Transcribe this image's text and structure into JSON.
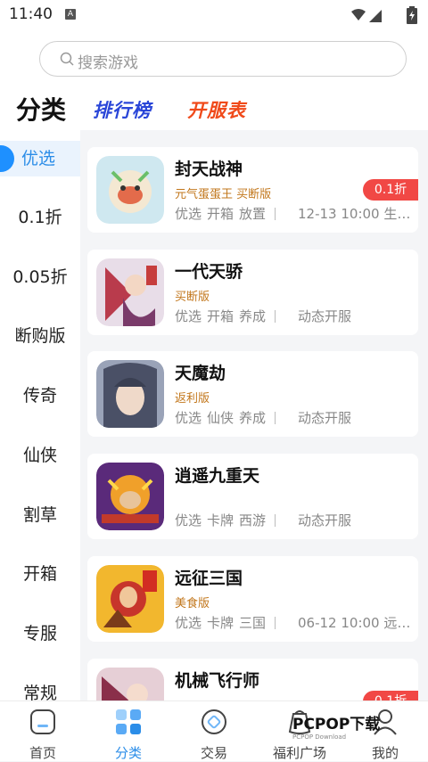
{
  "status_bar": {
    "time": "11:40",
    "notif_icon": "A"
  },
  "search": {
    "placeholder": "搜索游戏"
  },
  "tabs": {
    "main": "分类",
    "rank": "排行榜",
    "server": "开服表"
  },
  "sidebar": {
    "items": [
      {
        "label": "优选",
        "active": true
      },
      {
        "label": "0.1折"
      },
      {
        "label": "0.05折"
      },
      {
        "label": "断购版"
      },
      {
        "label": "传奇"
      },
      {
        "label": "仙侠"
      },
      {
        "label": "割草"
      },
      {
        "label": "开箱"
      },
      {
        "label": "专服"
      },
      {
        "label": "常规"
      }
    ]
  },
  "games": [
    {
      "name": "封天战神",
      "subtitle": "元气蛋蛋王 买断版",
      "tags": [
        "优选",
        "开箱",
        "放置"
      ],
      "open": "12-13 10:00 生…",
      "discount": "0.1折"
    },
    {
      "name": "一代天骄",
      "subtitle": "买断版",
      "tags": [
        "优选",
        "开箱",
        "养成"
      ],
      "open": "动态开服",
      "discount": ""
    },
    {
      "name": "天魔劫",
      "subtitle": "返利版",
      "tags": [
        "优选",
        "仙侠",
        "养成"
      ],
      "open": "动态开服",
      "discount": ""
    },
    {
      "name": "逍遥九重天",
      "subtitle": "",
      "tags": [
        "优选",
        "卡牌",
        "西游"
      ],
      "open": "动态开服",
      "discount": ""
    },
    {
      "name": "远征三国",
      "subtitle": "美食版",
      "tags": [
        "优选",
        "卡牌",
        "三国"
      ],
      "open": "06-12 10:00 远…",
      "discount": ""
    },
    {
      "name": "机械飞行师",
      "subtitle": "",
      "tags": [],
      "open": "",
      "discount": "0.1折"
    }
  ],
  "bottom_nav": {
    "home": "首页",
    "category": "分类",
    "trade": "交易",
    "welfare": "福利广场",
    "mine": "我的"
  },
  "watermark": {
    "brand": "PCPOP下载",
    "sub": "PCPOP Download"
  },
  "colors": {
    "accent": "#2b8de8",
    "discount": "#f14845",
    "rank": "#2a46d8",
    "server": "#f04a1a",
    "subtitle": "#c2771c"
  }
}
